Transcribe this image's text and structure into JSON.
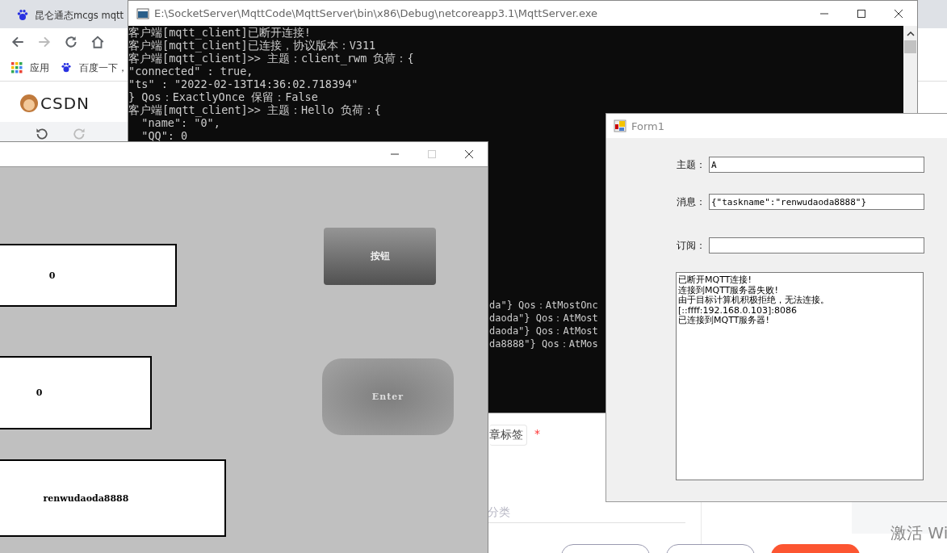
{
  "browser": {
    "tab": {
      "title": "昆仑通态mcgs mqtt"
    },
    "bookmarks": [
      {
        "label": "应用",
        "kind": "apps"
      },
      {
        "label": "百度一下，",
        "kind": "paw"
      }
    ],
    "logo": "CSDN",
    "page": {
      "tag": "章标签",
      "required_mark": "*",
      "category": {
        "placeholder": "分类"
      },
      "notice": "激活 Wi"
    }
  },
  "console_window": {
    "title": "E:\\SocketServer\\MqttCode\\MqttServer\\bin\\x86\\Debug\\netcoreapp3.1\\MqttServer.exe",
    "lines": [
      "客户端[mqtt_client]已断开连接!",
      "客户端[mqtt_client]已连接，协议版本：V311",
      "客户端[mqtt_client]>> 主题：client_rwm 负荷：{",
      "\"connected\" : true,",
      "\"ts\" : \"2022-02-13T14:36:02.718394\"",
      "} Qos：ExactlyOnce 保留：False",
      "客户端[mqtt_client]>> 主题：Hello 负荷：{",
      "  \"name\": \"0\",",
      "  \"QQ\": 0"
    ],
    "partial_lines": [
      "da\"} Qos：AtMostOnc",
      "daoda\"} Qos：AtMost",
      "daoda\"} Qos：AtMost",
      "da8888\"} Qos：AtMos"
    ]
  },
  "hmi_window": {
    "displays": [
      {
        "value": "0"
      },
      {
        "value": "0"
      },
      {
        "value": "renwudaoda8888"
      }
    ],
    "buttons": [
      {
        "label": "按钮",
        "kind": "linear"
      },
      {
        "label": "Enter",
        "kind": "radial"
      }
    ]
  },
  "form_window": {
    "title": "Form1",
    "fields": [
      {
        "label": "主题：",
        "value": "A"
      },
      {
        "label": "消息：",
        "value": "{\"taskname\":\"renwudaoda8888\"}"
      },
      {
        "label": "订阅："
      }
    ],
    "log": [
      "已断开MQTT连接!",
      "连接到MQTT服务器失败!",
      "由于目标计算机积极拒绝，无法连接。",
      "[::ffff:192.168.0.103]:8086",
      "已连接到MQTT服务器!"
    ]
  }
}
